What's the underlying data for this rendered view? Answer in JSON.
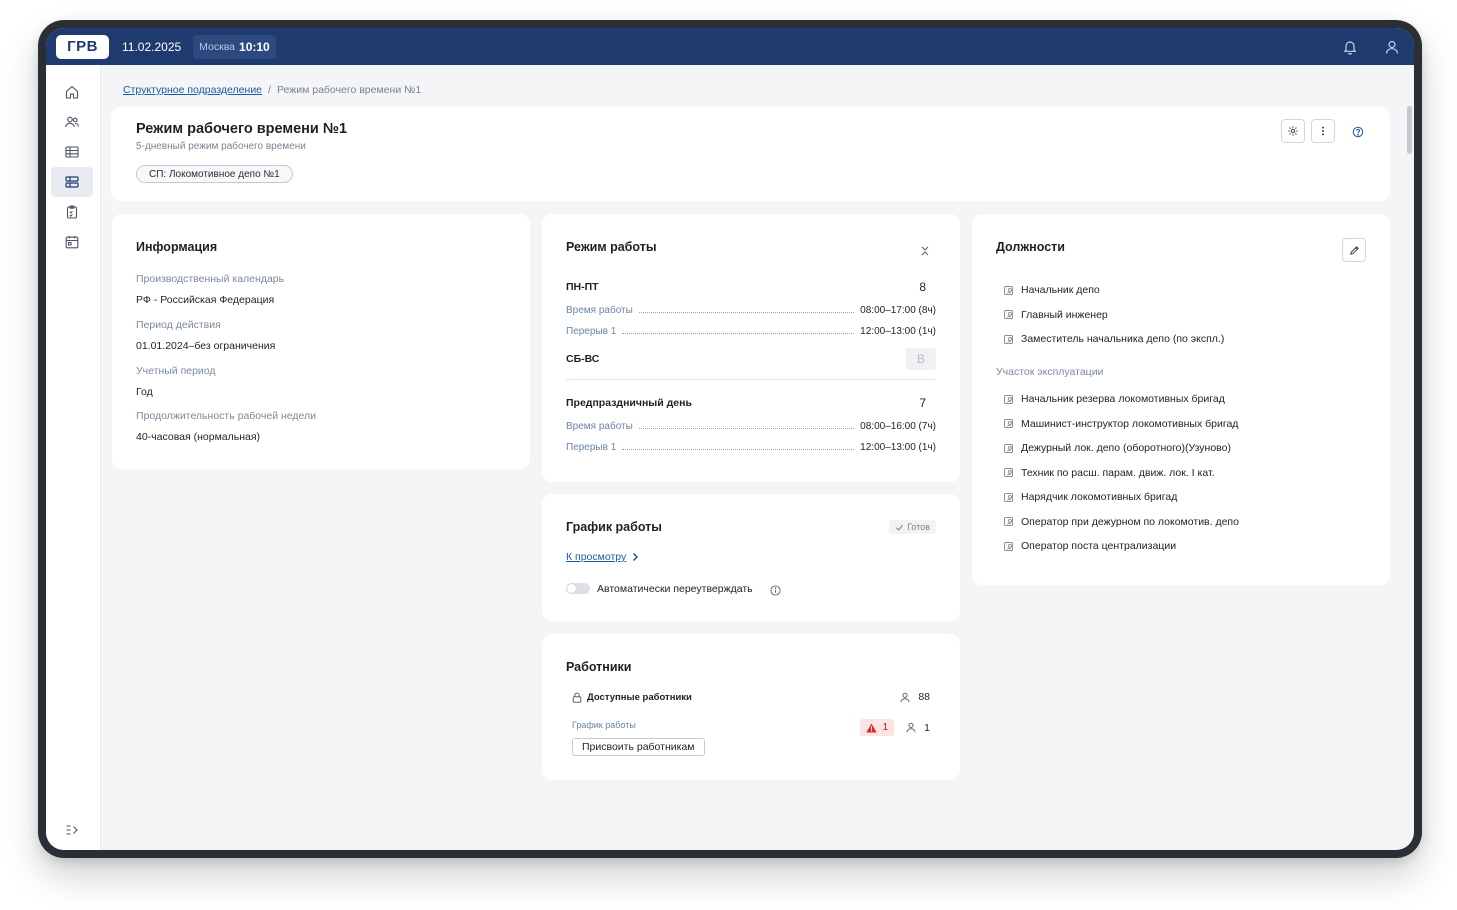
{
  "topbar": {
    "logo": "ГРВ",
    "date": "11.02.2025",
    "city": "Москва",
    "time": "10:10",
    "icons": [
      "bell-icon",
      "user-icon"
    ]
  },
  "sidebar": {
    "items": [
      {
        "icon": "home-icon"
      },
      {
        "icon": "users-icon"
      },
      {
        "icon": "table-icon"
      },
      {
        "icon": "schedule-icon",
        "active": true
      },
      {
        "icon": "clipboard-icon"
      },
      {
        "icon": "calendar-icon"
      }
    ],
    "expand_icon": "expand-sidebar-icon"
  },
  "breadcrumb": {
    "parent": "Структурное подразделение",
    "separator": "/",
    "current": "Режим рабочего времени №1"
  },
  "header": {
    "title": "Режим рабочего времени №1",
    "subtitle": "5-дневный режим рабочего времени",
    "chip": "СП: Локомотивное депо №1"
  },
  "info": {
    "title": "Информация",
    "fields": [
      {
        "label": "Производственный календарь",
        "value": "РФ - Российская Федерация"
      },
      {
        "label": "Период действия",
        "value": "01.01.2024–без ограничения"
      },
      {
        "label": "Учетный период",
        "value": "Год"
      },
      {
        "label": "Продолжительность рабочей недели",
        "value": "40-часовая (нормальная)"
      }
    ]
  },
  "mode": {
    "title": "Режим работы",
    "weekday": {
      "name": "ПН-ПТ",
      "hours": "8",
      "work_label": "Время работы",
      "work_value": "08:00–17:00 (8ч)",
      "break_label": "Перерыв 1",
      "break_value": "12:00–13:00 (1ч)"
    },
    "weekend": {
      "name": "СБ-ВС",
      "mark": "В"
    },
    "preholiday": {
      "name": "Предпраздничный день",
      "hours": "7",
      "work_label": "Время работы",
      "work_value": "08:00–16:00 (7ч)",
      "break_label": "Перерыв 1",
      "break_value": "12:00–13:00 (1ч)"
    }
  },
  "schedule": {
    "title": "График работы",
    "status": "Готов",
    "link": "К просмотру",
    "toggle_label": "Автоматически переутверждать",
    "toggle_on": false
  },
  "workers": {
    "title": "Работники",
    "available_label": "Доступные работники",
    "available_count": "88",
    "schedule_label": "График работы",
    "alert_count": "1",
    "assigned_count": "1",
    "assign_button": "Присвоить работникам"
  },
  "positions": {
    "title": "Должности",
    "items": [
      "Начальник депо",
      "Главный инженер",
      "Заместитель начальника депо (по экспл.)"
    ],
    "section": "Участок эксплуатации",
    "section_items": [
      "Начальник резерва локомотивных бригад",
      "Машинист-инструктор локомотивных бригад",
      "Дежурный лок. депо (оборотного)(Узуново)",
      "Техник по расш. парам. движ. лок. I кат.",
      "Нарядчик локомотивных бригад",
      "Оператор при дежурном по локомотив. депо",
      "Оператор поста централизации"
    ]
  },
  "colors": {
    "topbar": "#1f3a6e",
    "link": "#1f5aa6",
    "label": "#7a8aa0",
    "alert": "#b91c1c"
  }
}
